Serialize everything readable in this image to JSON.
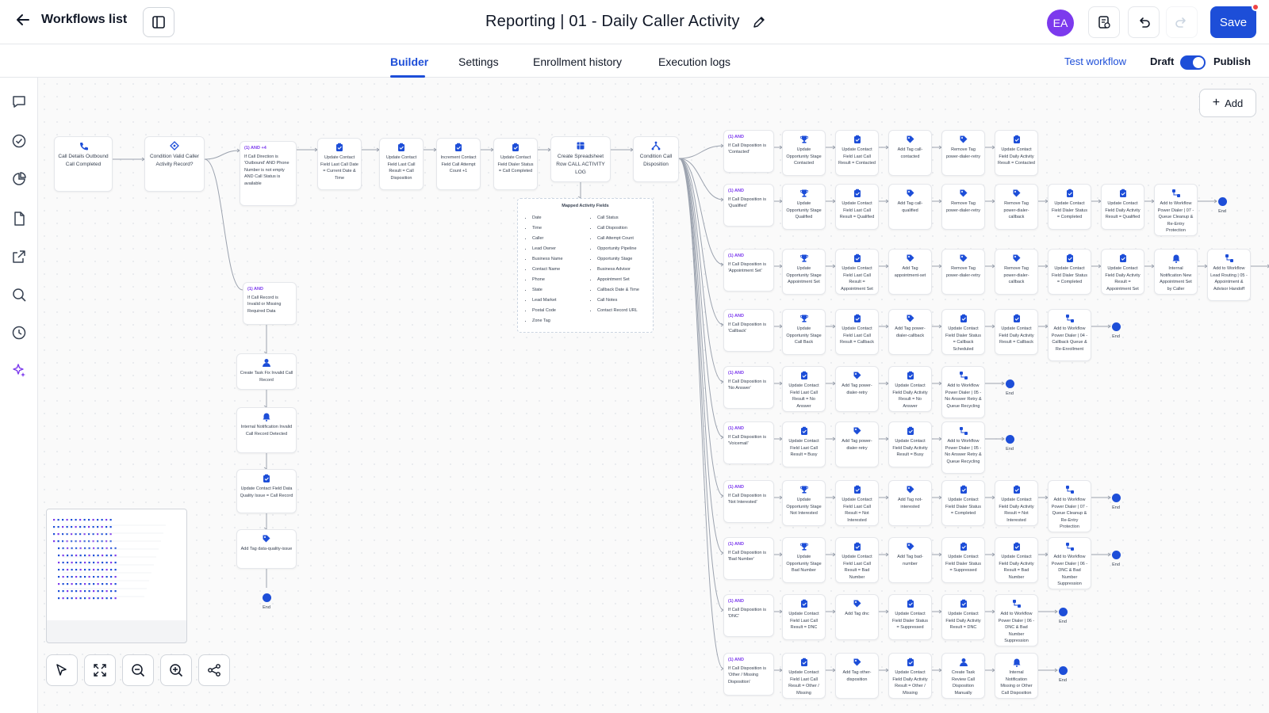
{
  "header": {
    "back_label": "Workflows list",
    "title": "Reporting | 01 - Daily Caller Activity",
    "avatar_initials": "EA",
    "save_label": "Save"
  },
  "tabs": [
    {
      "label": "Builder",
      "active": true
    },
    {
      "label": "Settings",
      "active": false
    },
    {
      "label": "Enrollment history",
      "active": false
    },
    {
      "label": "Execution logs",
      "active": false
    }
  ],
  "actions": {
    "test_workflow": "Test workflow",
    "draft_label": "Draft",
    "publish_label": "Publish",
    "publish_toggle_on": true
  },
  "canvas": {
    "add_label": "Add"
  },
  "colors": {
    "accent": "#1d4ed8",
    "condition": "#7c3aed",
    "avatar": "#7c3aed",
    "notification_dot": "#ef4444"
  },
  "nodes": {
    "trigger": "Call Details Outbound Call Completed",
    "valid_condition": "Condition Valid Caller Activity Record?",
    "branch_a_hd": "(1) AND +4",
    "branch_a_text": "If Call Direction is 'Outbound' AND Phone Number is not empty AND Call Status is available",
    "upd_last_call_date": "Update Contact Field Last Call Date = Current Date & Time",
    "upd_last_call_result": "Update Contact Field Last Call Result = Call Disposition",
    "increment_attempt": "Increment Contact Field Call Attempt Count +1",
    "upd_dialer_completed": "Update Contact Field Dialer Status = Call Completed",
    "create_sheet_row": "Create Spreadsheet Row CALL ACTIVITY LOG",
    "disposition_condition": "Condition Call Disposition",
    "invalid_hd": "(1) AND",
    "invalid_text": "If Call Record is Invalid or Missing Required Data",
    "create_task_invalid": "Create Task Fix Invalid Call Record",
    "notif_invalid": "Internal Notification Invalid Call Record Detected",
    "upd_data_quality": "Update Contact Field Data Quality Issue = Call Record",
    "tag_data_quality": "Add Tag data-quality-issue",
    "end_label": "End"
  },
  "mapped_fields": {
    "title": "Mapped Activity Fields",
    "left": [
      "Date",
      "Time",
      "Caller",
      "Lead Owner",
      "Business Name",
      "Contact Name",
      "Phone",
      "State",
      "Lead Market",
      "Postal Code",
      "Zone Tag"
    ],
    "right": [
      "Call Status",
      "Call Disposition",
      "Call Attempt Count",
      "Opportunity Pipeline",
      "Opportunity Stage",
      "Business Advisor",
      "Appointment Set",
      "Callback Date & Time",
      "Call Notes",
      "Contact Record URL"
    ]
  },
  "branches": [
    {
      "hd": "(1) AND",
      "cond": "If Call Disposition is 'Contacted'",
      "steps": [
        "Update Opportunity Stage Contacted",
        "Update Contact Field Last Call Result = Contacted",
        "Add Tag call-contacted",
        "Remove Tag power-dialer-retry",
        "Update Contact Field Daily Activity Result = Contacted"
      ],
      "end": false
    },
    {
      "hd": "(1) AND",
      "cond": "If Call Disposition is 'Qualified'",
      "steps": [
        "Update Opportunity Stage Qualified",
        "Update Contact Field Last Call Result = Qualified",
        "Add Tag call-qualified",
        "Remove Tag power-dialer-retry",
        "Remove Tag power-dialer-callback",
        "Update Contact Field Dialer Status = Completed",
        "Update Contact Field Daily Activity Result = Qualified",
        "Add to Workflow Power Dialer | 07 - Queue Cleanup & Re-Entry Protection"
      ],
      "end": true
    },
    {
      "hd": "(1) AND",
      "cond": "If Call Disposition is 'Appointment Set'",
      "steps": [
        "Update Opportunity Stage Appointment Set",
        "Update Contact Field Last Call Result = Appointment Set",
        "Add Tag appointment-set",
        "Remove Tag power-dialer-retry",
        "Remove Tag power-dialer-callback",
        "Update Contact Field Dialer Status = Completed",
        "Update Contact Field Daily Activity Result = Appointment Set",
        "Internal Notification New Appointment Set by Caller",
        "Add to Workflow Lead Routing | 05 - Appointment & Advisor Handoff"
      ],
      "end": true
    },
    {
      "hd": "(1) AND",
      "cond": "If Call Disposition is 'Callback'",
      "steps": [
        "Update Opportunity Stage Call Back",
        "Update Contact Field Last Call Result = Callback",
        "Add Tag power-dialer-callback",
        "Update Contact Field Dialer Status = Callback Scheduled",
        "Update Contact Field Daily Activity Result = Callback",
        "Add to Workflow Power Dialer | 04 - Callback Queue & Re-Enrollment"
      ],
      "end": true
    },
    {
      "hd": "(1) AND",
      "cond": "If Call Disposition is 'No Answer'",
      "steps": [
        "Update Contact Field Last Call Result = No Answer",
        "Add Tag power-dialer-retry",
        "Update Contact Field Daily Activity Result = No Answer",
        "Add to Workflow Power Dialer | 05 - No Answer Retry & Queue Recycling"
      ],
      "end": true
    },
    {
      "hd": "(1) AND",
      "cond": "If Call Disposition is 'Voicemail'",
      "steps": [
        "Update Contact Field Last Call Result = Busy",
        "Add Tag power-dialer-retry",
        "Update Contact Field Daily Activity Result = Busy",
        "Add to Workflow Power Dialer | 05 - No Answer Retry & Queue Recycling"
      ],
      "end": true
    },
    {
      "hd": "(1) AND",
      "cond": "If Call Disposition is 'Not Interested'",
      "steps": [
        "Update Opportunity Stage Not Interested",
        "Update Contact Field Last Call Result = Not Interested",
        "Add Tag not-interested",
        "Update Contact Field Dialer Status = Completed",
        "Update Contact Field Daily Activity Result = Not Interested",
        "Add to Workflow Power Dialer | 07 - Queue Cleanup & Re-Entry Protection"
      ],
      "end": true
    },
    {
      "hd": "(1) AND",
      "cond": "If Call Disposition is 'Bad Number'",
      "steps": [
        "Update Opportunity Stage Bad Number",
        "Update Contact Field Last Call Result = Bad Number",
        "Add Tag bad-number",
        "Update Contact Field Dialer Status = Suppressed",
        "Update Contact Field Daily Activity Result = Bad Number",
        "Add to Workflow Power Dialer | 06 - DNC & Bad Number Suppression"
      ],
      "end": true
    },
    {
      "hd": "(1) AND",
      "cond": "If Call Disposition is 'DNC'",
      "steps": [
        "Update Contact Field Last Call Result = DNC",
        "Add Tag dnc",
        "Update Contact Field Dialer Status = Suppressed",
        "Update Contact Field Daily Activity Result = DNC",
        "Add to Workflow Power Dialer | 06 - DNC & Bad Number Suppression"
      ],
      "end": true
    },
    {
      "hd": "(1) AND",
      "cond": "If Call Disposition is 'Other / Missing Disposition'",
      "steps": [
        "Update Contact Field Last Call Result = Other / Missing",
        "Add Tag other-disposition",
        "Update Contact Field Daily Activity Result = Other / Missing",
        "Create Task Review Call Disposition Manually",
        "Internal Notification Missing or Other Call Disposition"
      ],
      "end": true
    }
  ]
}
